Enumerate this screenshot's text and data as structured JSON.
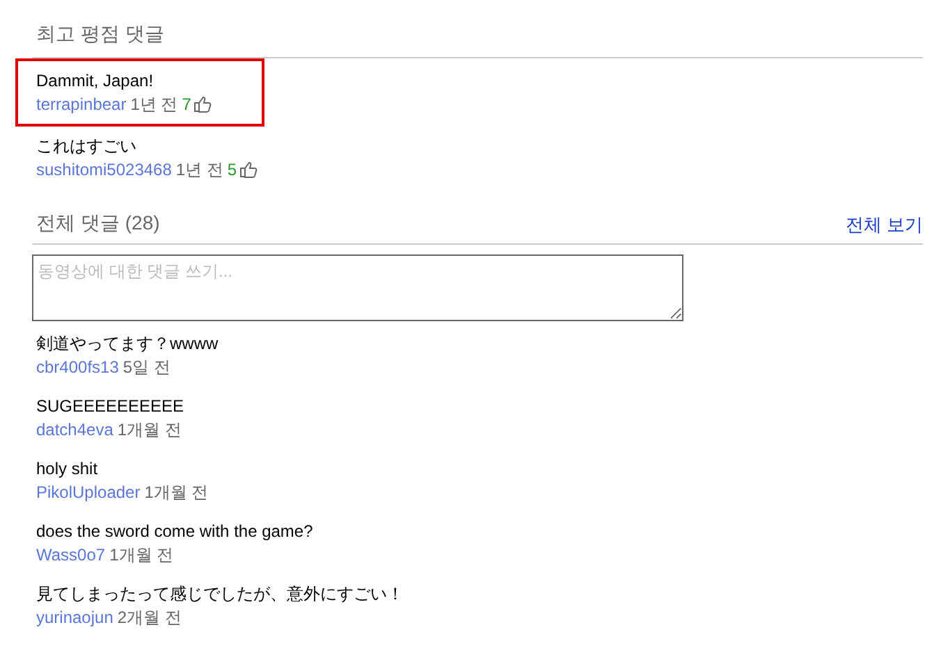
{
  "top_comments": {
    "title": "최고 평점 댓글",
    "comments": [
      {
        "text": "Dammit, Japan!",
        "author": "terrapinbear",
        "time": "1년 전",
        "likes": "7",
        "highlighted": true
      },
      {
        "text": "これはすごい",
        "author": "sushitomi5023468",
        "time": "1년 전",
        "likes": "5",
        "highlighted": false
      }
    ]
  },
  "all_comments": {
    "title": "전체 댓글",
    "count": "(28)",
    "view_all": "전체 보기",
    "input": {
      "placeholder": "동영상에 대한 댓글 쓰기..."
    },
    "comments": [
      {
        "text": "剣道やってます？wwww",
        "author": "cbr400fs13",
        "time": "5일 전"
      },
      {
        "text": "SUGEEEEEEEEEE",
        "author": "datch4eva",
        "time": "1개월 전"
      },
      {
        "text": "holy shit",
        "author": "PikolUploader",
        "time": "1개월 전"
      },
      {
        "text": "does the sword come with the game?",
        "author": "Wass0o7",
        "time": "1개월 전"
      },
      {
        "text": "見てしまったって感じでしたが、意外にすごい！",
        "author": "yurinaojun",
        "time": "2개월 전"
      }
    ]
  }
}
